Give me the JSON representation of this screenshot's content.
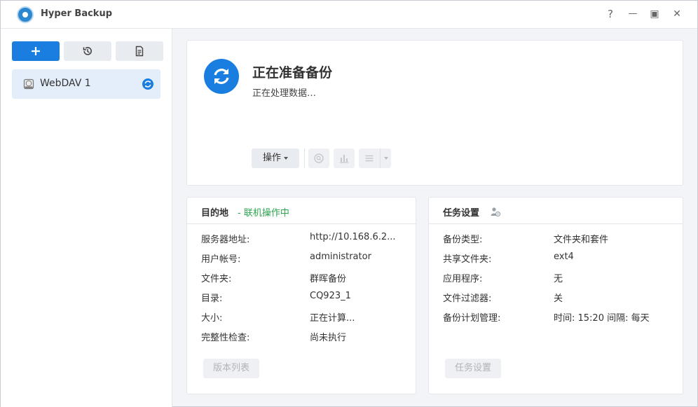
{
  "titlebar": {
    "app_title": "Hyper Backup",
    "help": "?",
    "minimize": "—",
    "maximize": "▣",
    "close": "✕"
  },
  "sidebar": {
    "add_icon": "plus-icon",
    "history_icon": "restore-icon",
    "log_icon": "document-icon",
    "items": [
      {
        "label": "WebDAV 1",
        "icon": "hard-disk-icon",
        "status_icon": "sync-icon"
      }
    ]
  },
  "status": {
    "title": "正在准备备份",
    "subtitle": "正在处理数据…",
    "ops_label": "操作"
  },
  "destination": {
    "title": "目的地",
    "status": "- 联机操作中",
    "status_color": "#2da44e",
    "rows": [
      {
        "key": "服务器地址:",
        "value": "http://10.168.6.2..."
      },
      {
        "key": "用户帐号:",
        "value": "administrator"
      },
      {
        "key": "文件夹:",
        "value": "群晖备份"
      },
      {
        "key": "目录:",
        "value": "CQ923_1"
      },
      {
        "key": "大小:",
        "value": "正在计算..."
      },
      {
        "key": "完整性检查:",
        "value": "尚未执行"
      }
    ],
    "button": "版本列表"
  },
  "task": {
    "title": "任务设置",
    "rows": [
      {
        "key": "备份类型:",
        "value": "文件夹和套件"
      },
      {
        "key": "共享文件夹:",
        "value": "ext4"
      },
      {
        "key": "应用程序:",
        "value": "无"
      },
      {
        "key": "文件过滤器:",
        "value": "关"
      },
      {
        "key": "备份计划管理:",
        "value": "时间: 15:20 间隔: 每天"
      }
    ],
    "button": "任务设置"
  },
  "colors": {
    "accent": "#1a7ee0",
    "selected_bg": "#e4eefa",
    "online_green": "#2da44e"
  }
}
